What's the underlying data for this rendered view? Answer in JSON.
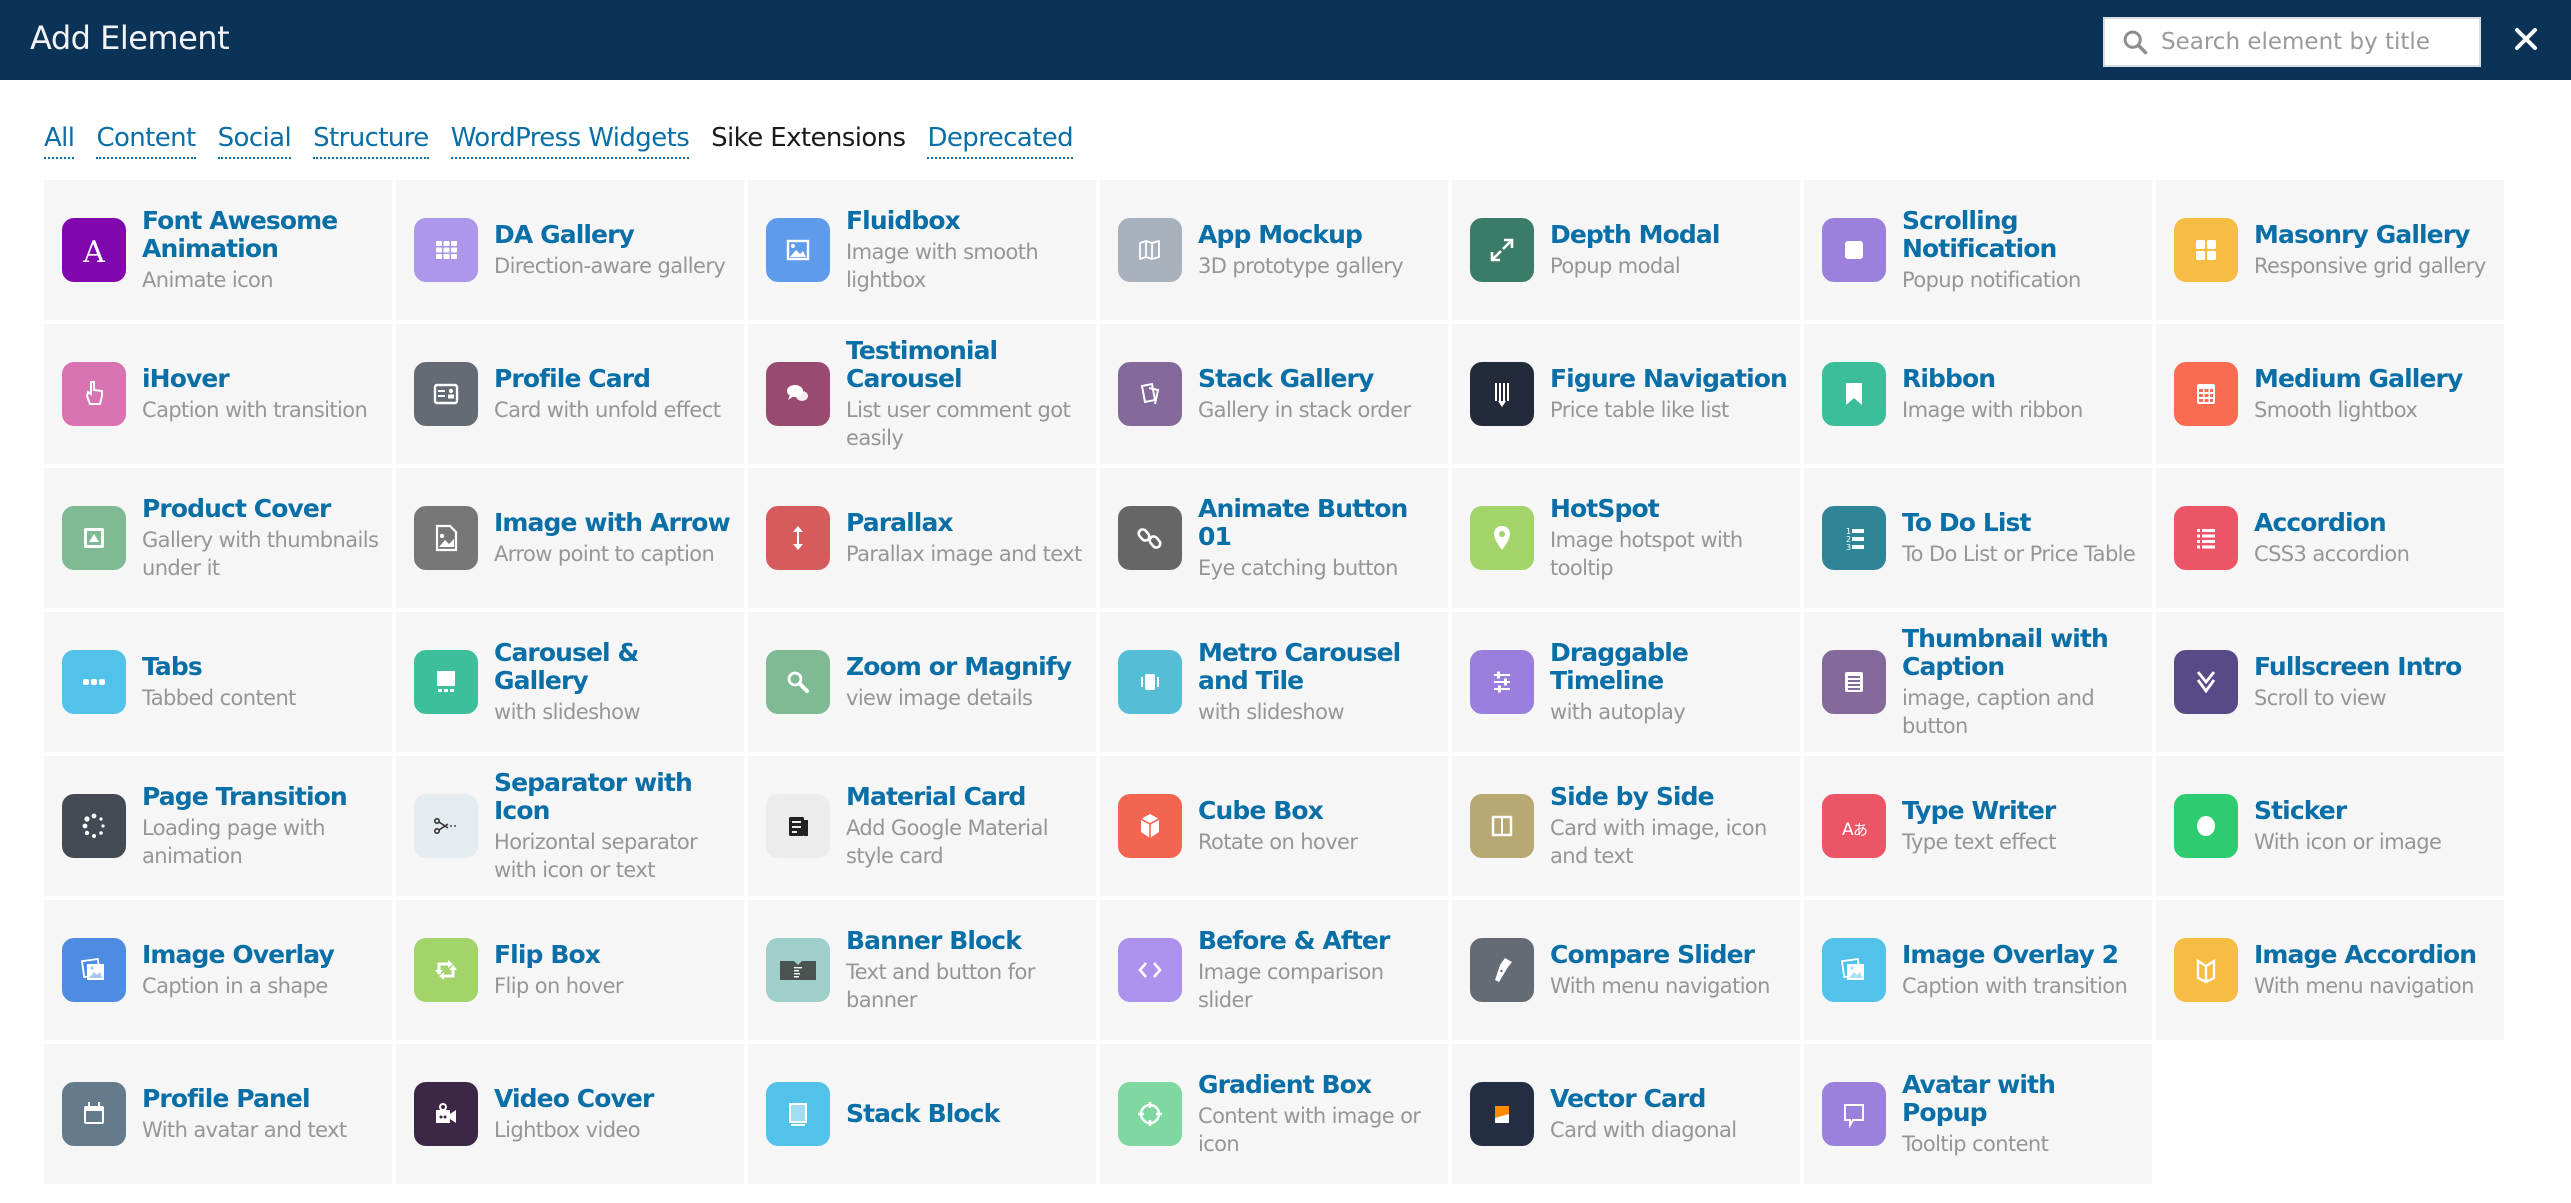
{
  "header": {
    "title": "Add Element",
    "search_placeholder": "Search element by title",
    "search_value": "",
    "close_label": "×"
  },
  "tabs": [
    {
      "label": "All",
      "active": false
    },
    {
      "label": "Content",
      "active": false
    },
    {
      "label": "Social",
      "active": false
    },
    {
      "label": "Structure",
      "active": false
    },
    {
      "label": "WordPress Widgets",
      "active": false
    },
    {
      "label": "Sike Extensions",
      "active": true
    },
    {
      "label": "Deprecated",
      "active": false
    }
  ],
  "elements": [
    {
      "title": "Font Awesome Animation",
      "desc": "Animate icon",
      "icon": "font-letter-a-icon",
      "color": "#8007ae"
    },
    {
      "title": "DA Gallery",
      "desc": "Direction-aware gallery",
      "icon": "grid-icon",
      "color": "#ad97ea"
    },
    {
      "title": "Fluidbox",
      "desc": "Image with smooth lightbox",
      "icon": "image-icon",
      "color": "#5e9ceb"
    },
    {
      "title": "App Mockup",
      "desc": "3D prototype gallery",
      "icon": "map-icon",
      "color": "#a9b1bc"
    },
    {
      "title": "Depth Modal",
      "desc": "Popup modal",
      "icon": "expand-icon",
      "color": "#3b7c68"
    },
    {
      "title": "Scrolling Notification",
      "desc": "Popup notification",
      "icon": "square-icon",
      "color": "#9b81dc"
    },
    {
      "title": "Masonry Gallery",
      "desc": "Responsive grid gallery",
      "icon": "masonry-icon",
      "color": "#f6bc44"
    },
    {
      "title": "iHover",
      "desc": "Caption with transition",
      "icon": "pointer-hand-icon",
      "color": "#d872b0"
    },
    {
      "title": "Profile Card",
      "desc": "Card with unfold effect",
      "icon": "id-card-icon",
      "color": "#646b75"
    },
    {
      "title": "Testimonial Carousel",
      "desc": "List user comment got easily",
      "icon": "comments-icon",
      "color": "#984b6e"
    },
    {
      "title": "Stack Gallery",
      "desc": "Gallery in stack order",
      "icon": "stack-cards-icon",
      "color": "#836a9b"
    },
    {
      "title": "Figure Navigation",
      "desc": "Price table like list",
      "icon": "pencil-lines-icon",
      "color": "#232a3a"
    },
    {
      "title": "Ribbon",
      "desc": "Image with ribbon",
      "icon": "bookmark-icon",
      "color": "#3cbe9a"
    },
    {
      "title": "Medium Gallery",
      "desc": "Smooth lightbox",
      "icon": "table-icon",
      "color": "#fa6c51"
    },
    {
      "title": "Product Cover",
      "desc": "Gallery with thumbnails under it",
      "icon": "picture-frame-icon",
      "color": "#7fba94"
    },
    {
      "title": "Image with Arrow",
      "desc": "Arrow point to caption",
      "icon": "file-image-icon",
      "color": "#777777"
    },
    {
      "title": "Parallax",
      "desc": "Parallax image and text",
      "icon": "vertical-arrows-icon",
      "color": "#d65b5d"
    },
    {
      "title": "Animate Button 01",
      "desc": "Eye catching button",
      "icon": "link-icon",
      "color": "#666666"
    },
    {
      "title": "HotSpot",
      "desc": "Image hotspot with tooltip",
      "icon": "map-pin-icon",
      "color": "#a2d46a"
    },
    {
      "title": "To Do List",
      "desc": "To Do List or Price Table",
      "icon": "numbered-list-icon",
      "color": "#2f8597"
    },
    {
      "title": "Accordion",
      "desc": "CSS3 accordion",
      "icon": "list-icon",
      "color": "#ec5566"
    },
    {
      "title": "Tabs",
      "desc": "Tabbed content",
      "icon": "dots-icon",
      "color": "#52c2ea"
    },
    {
      "title": "Carousel & Gallery",
      "desc": "with slideshow",
      "icon": "slideshow-icon",
      "color": "#3dbf9b"
    },
    {
      "title": "Zoom or Magnify",
      "desc": "view image details",
      "icon": "magnifier-icon",
      "color": "#7fba94"
    },
    {
      "title": "Metro Carousel and Tile",
      "desc": "with slideshow",
      "icon": "carousel-icon",
      "color": "#55bdd6"
    },
    {
      "title": "Draggable Timeline",
      "desc": "with autoplay",
      "icon": "sliders-icon",
      "color": "#9a7fdc"
    },
    {
      "title": "Thumbnail with Caption",
      "desc": "image, caption and button",
      "icon": "document-list-icon",
      "color": "#836a9b"
    },
    {
      "title": "Fullscreen Intro",
      "desc": "Scroll to view",
      "icon": "double-chevron-down-icon",
      "color": "#574a86"
    },
    {
      "title": "Page Transition",
      "desc": "Loading page with animation",
      "icon": "spinner-icon",
      "color": "#434a54"
    },
    {
      "title": "Separator with Icon",
      "desc": "Horizontal separator with icon or text",
      "icon": "scissors-icon",
      "color": "#e5ecf0"
    },
    {
      "title": "Material Card",
      "desc": "Add Google Material style card",
      "icon": "newspaper-icon",
      "color": "#ececec"
    },
    {
      "title": "Cube Box",
      "desc": "Rotate on hover",
      "icon": "cube-icon",
      "color": "#f26550"
    },
    {
      "title": "Side by Side",
      "desc": "Card with image, icon and text",
      "icon": "columns-icon",
      "color": "#b8a874"
    },
    {
      "title": "Type Writer",
      "desc": "Type text effect",
      "icon": "translate-icon",
      "color": "#ec5566"
    },
    {
      "title": "Sticker",
      "desc": "With icon or image",
      "icon": "circle-icon",
      "color": "#2ecc71"
    },
    {
      "title": "Image Overlay",
      "desc": "Caption in a shape",
      "icon": "images-icon",
      "color": "#4d8ce0"
    },
    {
      "title": "Flip Box",
      "desc": "Flip on hover",
      "icon": "retweet-icon",
      "color": "#a2d46a"
    },
    {
      "title": "Banner Block",
      "desc": "Text and button for banner",
      "icon": "banner-icon",
      "color": "#9fcfca"
    },
    {
      "title": "Before & After",
      "desc": "Image comparison slider",
      "icon": "code-brackets-icon",
      "color": "#ac92ec"
    },
    {
      "title": "Compare Slider",
      "desc": "With menu navigation",
      "icon": "flashlight-icon",
      "color": "#646b75"
    },
    {
      "title": "Image Overlay 2",
      "desc": "Caption with transition",
      "icon": "images-icon",
      "color": "#52c2ea"
    },
    {
      "title": "Image Accordion",
      "desc": "With menu navigation",
      "icon": "book-open-icon",
      "color": "#f6bc44"
    },
    {
      "title": "Profile Panel",
      "desc": "With avatar and text",
      "icon": "calendar-icon",
      "color": "#637b8a"
    },
    {
      "title": "Video Cover",
      "desc": "Lightbox video",
      "icon": "video-camera-icon",
      "color": "#3c2747"
    },
    {
      "title": "Stack Block",
      "desc": "",
      "icon": "monitor-icon",
      "color": "#52c2ea"
    },
    {
      "title": "Gradient Box",
      "desc": "Content with image or icon",
      "icon": "crosshair-icon",
      "color": "#7fd8a0"
    },
    {
      "title": "Vector Card",
      "desc": "Card with diagonal",
      "icon": "diagonal-card-icon",
      "color": "#232d43"
    },
    {
      "title": "Avatar with Popup",
      "desc": "Tooltip content",
      "icon": "speech-bubble-icon",
      "color": "#9b81dc"
    }
  ]
}
